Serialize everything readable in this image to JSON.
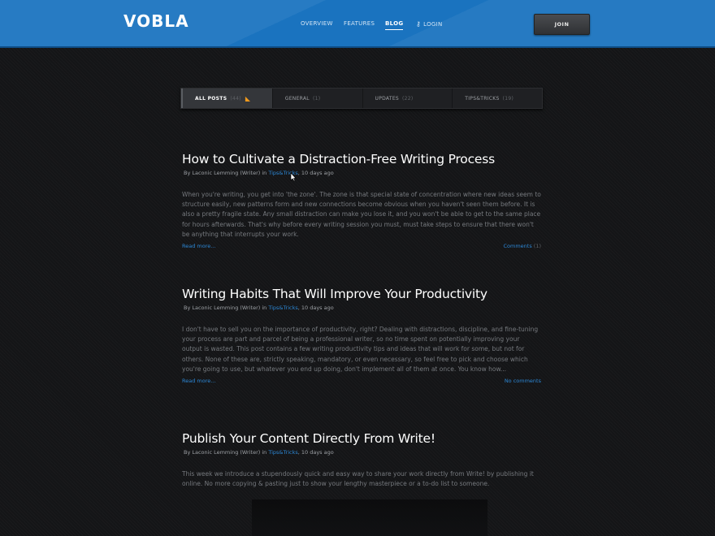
{
  "header": {
    "logo": "VOBLA",
    "nav": [
      {
        "label": "OVERVIEW"
      },
      {
        "label": "FEATURES"
      },
      {
        "label": "BLOG"
      },
      {
        "label": "LOGIN"
      }
    ],
    "join_label": "JOIN",
    "brand_color": "#1a73bf"
  },
  "tabs": [
    {
      "label": "ALL POSTS",
      "count": "(44)"
    },
    {
      "label": "GENERAL",
      "count": "(1)"
    },
    {
      "label": "UPDATES",
      "count": "(22)"
    },
    {
      "label": "TIPS&TRICKS",
      "count": "(19)"
    }
  ],
  "posts": [
    {
      "title": "How to Cultivate a Distraction-Free Writing Process",
      "meta_prefix": "By Laconic Lemming (Writer) in ",
      "category": "Tips&Tricks",
      "meta_suffix": ", 10 days ago",
      "body": "When you're writing, you get into 'the zone'. The zone is that special state of concentration where new ideas seem to structure easily, new patterns form and new connections become obvious when you haven't seen them before. It is also a pretty fragile state. Any small distraction can make you lose it, and you won't be able to get to the same place for hours afterwards. That's why before every writing session you must, must take steps to ensure that there won't be anything that interrupts your work.",
      "read_more": "Read more...",
      "comments": "Comments",
      "comments_count": "(1)"
    },
    {
      "title": "Writing Habits That Will Improve Your Productivity",
      "meta_prefix": "By Laconic Lemming (Writer) in ",
      "category": "Tips&Tricks",
      "meta_suffix": ", 10 days ago",
      "body": "I don't have to sell you on the importance of productivity, right? Dealing with distractions, discipline, and fine-tuning your process are part and parcel of being a professional writer, so no time spent on potentially improving your output is wasted. This post contains a few writing productivity tips and ideas that will work for some, but not for others. None of these are, strictly speaking, mandatory, or even necessary, so feel free to pick and choose which you're going to use, but whatever you end up doing, don't implement all of them at once. You know how...",
      "read_more": "Read more...",
      "comments": "No comments"
    },
    {
      "title": "Publish Your Content Directly From Write!",
      "meta_prefix": "By Laconic Lemming (Writer) in ",
      "category": "Tips&Tricks",
      "meta_suffix": ", 10 days ago",
      "body": "This week we introduce a stupendously quick and easy way to share your work directly from Write! by publishing it online. No more copying & pasting just to show your lengthy masterpiece or a to-do list to someone."
    }
  ]
}
